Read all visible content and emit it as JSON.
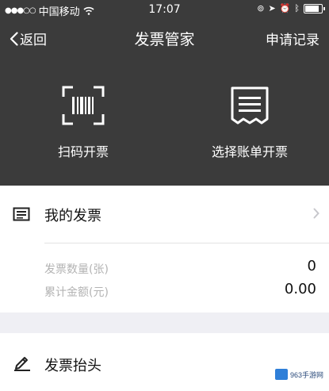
{
  "status_bar": {
    "carrier": "中国移动",
    "time": "17:07",
    "battery_level": 0.85
  },
  "nav": {
    "back_label": "返回",
    "title": "发票管家",
    "right_label": "申请记录"
  },
  "actions": [
    {
      "label": "扫码开票",
      "icon": "barcode-scan-icon"
    },
    {
      "label": "选择账单开票",
      "icon": "receipt-icon"
    }
  ],
  "my_invoices": {
    "label": "我的发票",
    "icon": "invoice-list-icon",
    "stats": [
      {
        "label": "发票数量(张)",
        "value": "0"
      },
      {
        "label": "累计金额(元)",
        "value": "0.00"
      }
    ]
  },
  "invoice_header": {
    "label": "发票抬头",
    "icon": "pencil-icon"
  },
  "watermark": {
    "text": "963手游网"
  },
  "colors": {
    "header_bg": "#3b3b3b",
    "page_bg": "#efeff4",
    "card_bg": "#ffffff"
  }
}
